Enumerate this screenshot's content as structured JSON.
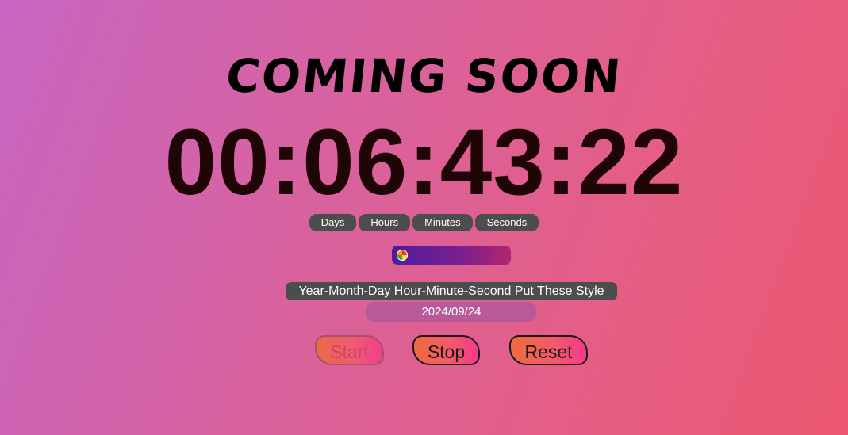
{
  "title": "COMING SOON",
  "countdown": "00:06:43:22",
  "units": [
    "Days",
    "Hours",
    "Minutes",
    "Seconds"
  ],
  "hint": "Year-Month-Day Hour-Minute-Second Put These Style",
  "date": "2024/09/24",
  "buttons": {
    "start": "Start",
    "stop": "Stop",
    "reset": "Reset"
  },
  "picker_icon": "color-wheel-icon",
  "colors": {
    "background_start": "#c866c2",
    "background_end": "#ec5870",
    "button_gradient_start": "#f06a3c",
    "button_gradient_end": "#f43a8c",
    "picker_start": "#4b1e9c",
    "picker_end": "#b0266f"
  },
  "state": {
    "start_disabled": true
  }
}
